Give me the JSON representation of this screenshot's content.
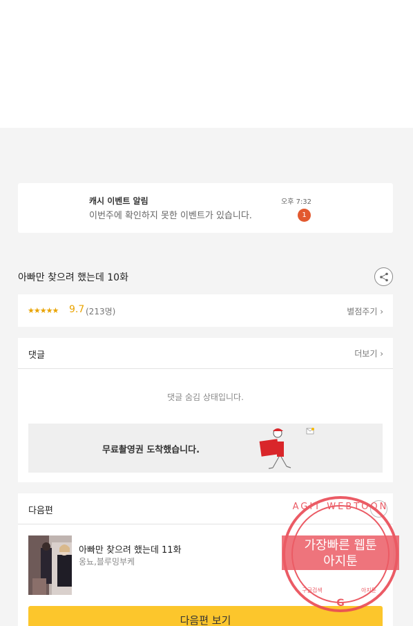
{
  "notification": {
    "title": "캐시 이벤트 알림",
    "message": "이번주에 확인하지 못한 이벤트가 있습니다.",
    "time": "오후 7:32",
    "badge": "1"
  },
  "episode": {
    "title": "아빠만 찾으려 했는데 10화",
    "stars": "★★★★★",
    "score": "9.7",
    "count": "(213명)",
    "rate_link": "별점주기 ›"
  },
  "comments": {
    "title": "댓글",
    "more": "더보기 ›",
    "hidden_message": "댓글 숨김 상태입니다."
  },
  "promo": {
    "text": "무료촬영권 도착했습니다."
  },
  "next": {
    "section_title": "다음편",
    "title": "아빠만 찾으려 했는데 11화",
    "author": "옹뇨,블루밍부케",
    "button": "다음편 보기"
  },
  "watermark": {
    "ring_text": "AGIT WEBTOON",
    "line1": "가장빠른 웹툰",
    "line2": "아지툰",
    "bottom_left": "구글검색",
    "bottom_right": "아지툰"
  },
  "colors": {
    "accent_yellow": "#fcc62c",
    "star_orange": "#e9a300",
    "badge_red": "#e2592f",
    "watermark_red": "#e94a55"
  }
}
